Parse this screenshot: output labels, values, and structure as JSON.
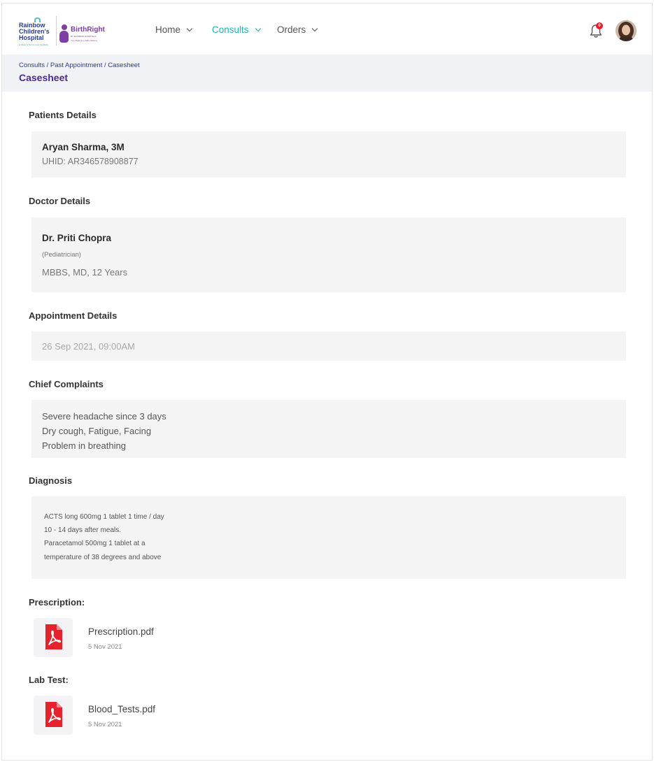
{
  "brand": {
    "rainbow_lines": [
      "Rainbow",
      "Children's",
      "Hospital"
    ],
    "rainbow_tagline": "A Value is Not to Lose the Baby",
    "birthright_name": "BirthRight",
    "birthright_sub": "BY RAINBOW HOSPITALS",
    "birthright_tagline": "Your Right to a Safe Delivery",
    "colors": {
      "primary": "#4b2a8b",
      "accent": "#1fb3b3",
      "alert": "#e3202c"
    }
  },
  "nav": {
    "items": [
      {
        "label": "Home",
        "active": false
      },
      {
        "label": "Consults",
        "active": true
      },
      {
        "label": "Orders",
        "active": false
      }
    ],
    "notification_count": "0"
  },
  "breadcrumb": {
    "items": [
      "Consults",
      "Past Appointment",
      "Casesheet"
    ],
    "separator": " / ",
    "title": "Casesheet"
  },
  "patient": {
    "heading": "Patients Details",
    "name": "Aryan Sharma, 3M",
    "uhid": "UHID: AR346578908877"
  },
  "doctor": {
    "heading": "Doctor Details",
    "name": "Dr. Priti Chopra",
    "speciality": "(Pediatrician)",
    "qualification": "MBBS, MD, 12 Years"
  },
  "appointment": {
    "heading": "Appointment Details",
    "datetime": "26 Sep 2021, 09:00AM"
  },
  "complaints": {
    "heading": "Chief Complaints",
    "lines": [
      "Severe headache since 3 days",
      "Dry cough, Fatigue, Facing",
      "Problem in breathing"
    ]
  },
  "diagnosis": {
    "heading": "Diagnosis",
    "lines": [
      "ACTS long 600mg 1 tablet 1 time / day",
      "10 - 14  days after meals.",
      "Paracetamol 500mg 1 tablet at a",
      "temperature of 38 degrees and above"
    ]
  },
  "prescription": {
    "heading": "Prescription:",
    "file": {
      "name": "Prescription.pdf",
      "date": "5 Nov 2021",
      "icon": "pdf-icon"
    }
  },
  "lab": {
    "heading": "Lab Test:",
    "file": {
      "name": "Blood_Tests.pdf",
      "date": "5 Nov 2021",
      "icon": "pdf-icon"
    }
  }
}
